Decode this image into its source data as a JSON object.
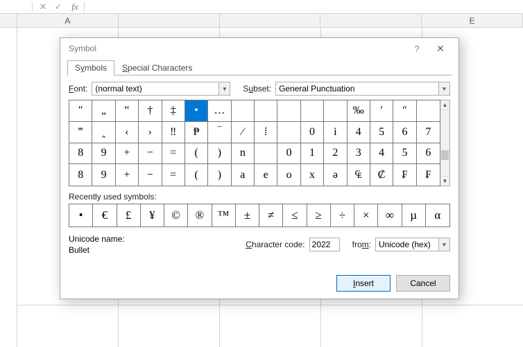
{
  "formula_bar": {
    "cancel": "✕",
    "accept": "✓",
    "fx": "fx",
    "value": ""
  },
  "columns": [
    "A",
    "",
    "",
    "",
    "E"
  ],
  "dialog": {
    "title": "Symbol",
    "help": "?",
    "close": "✕",
    "tabs": {
      "symbols_pre": "S",
      "symbols_ul": "y",
      "symbols_post": "mbols",
      "special_ul": "S",
      "special_post": "pecial Characters"
    },
    "font_label_pre": "",
    "font_label_ul": "F",
    "font_label_post": "ont:",
    "font_value": "(normal text)",
    "subset_label_pre": "S",
    "subset_label_ul": "u",
    "subset_label_post": "bset:",
    "subset_value": "General Punctuation",
    "grid": [
      "″",
      "„",
      "‟",
      "†",
      "‡",
      "•",
      "…",
      "",
      "",
      "",
      "",
      "",
      "‰",
      "′",
      "″",
      "",
      "‴",
      "‸",
      "‹",
      "›",
      "‼",
      "₱",
      "‾",
      "⁄",
      "⁞",
      "",
      "0",
      "i",
      "4",
      "5",
      "6",
      "7",
      "8",
      "9",
      "+",
      "−",
      "=",
      "(",
      ")",
      "n",
      "",
      "0",
      "1",
      "2",
      "3",
      "4",
      "5",
      "6",
      "8",
      "9",
      "+",
      "−",
      "=",
      "(",
      ")",
      "a",
      "e",
      "o",
      "x",
      "ə",
      "₠",
      "₡",
      "₣",
      "₣"
    ],
    "selected_index": 5,
    "recent_label_ul": "R",
    "recent_label_post": "ecently used symbols:",
    "recent": [
      "•",
      "€",
      "£",
      "¥",
      "©",
      "®",
      "™",
      "±",
      "≠",
      "≤",
      "≥",
      "÷",
      "×",
      "∞",
      "µ",
      "α"
    ],
    "unicode_name_label": "Unicode name:",
    "unicode_name_value": "Bullet",
    "charcode_label_ul": "C",
    "charcode_label_post": "haracter code:",
    "charcode_value": "2022",
    "from_label_pre": "fro",
    "from_label_ul": "m",
    "from_label_post": ":",
    "from_value": "Unicode (hex)",
    "insert_ul": "I",
    "insert_post": "nsert",
    "cancel": "Cancel"
  }
}
